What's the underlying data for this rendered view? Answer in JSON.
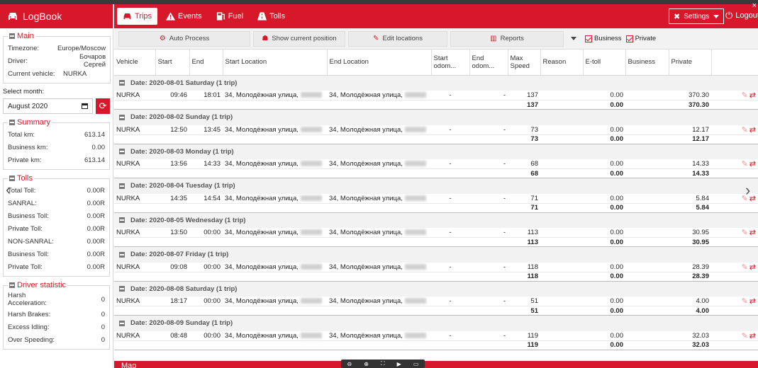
{
  "app": {
    "title": "LogBook"
  },
  "sidebar": {
    "main": {
      "legend": "Main",
      "rows": [
        {
          "k": "Timezone:",
          "v": "Europe/Moscow"
        },
        {
          "k": "Driver:",
          "v": "Бочаров Сергей"
        },
        {
          "k": "Current vehicle:",
          "v": "NURKA"
        }
      ]
    },
    "select_month_label": "Select month:",
    "month_value": "August 2020",
    "summary": {
      "legend": "Summary",
      "rows": [
        {
          "k": "Total km:",
          "v": "613.14"
        },
        {
          "k": "Business km:",
          "v": "0.00"
        },
        {
          "k": "Private km:",
          "v": "613.14"
        }
      ]
    },
    "tolls": {
      "legend": "Tolls",
      "rows": [
        {
          "k": "Total Toll:",
          "v": "0.00R"
        },
        {
          "k": "SANRAL:",
          "v": "0.00R"
        },
        {
          "k": "Business Toll:",
          "v": "0.00R"
        },
        {
          "k": "Private Toll:",
          "v": "0.00R"
        },
        {
          "k": "NON-SANRAL:",
          "v": "0.00R"
        },
        {
          "k": "Business Toll:",
          "v": "0.00R"
        },
        {
          "k": "Private Toll:",
          "v": "0.00R"
        }
      ]
    },
    "driver_stat": {
      "legend": "Driver statistic",
      "rows": [
        {
          "k": "Harsh Acceleration:",
          "v": "0"
        },
        {
          "k": "Harsh Brakes:",
          "v": "0"
        },
        {
          "k": "Excess Idling:",
          "v": "0"
        },
        {
          "k": "Over Speeding:",
          "v": "0"
        }
      ]
    }
  },
  "nav": {
    "tabs": [
      "Trips",
      "Events",
      "Fuel",
      "Tolls"
    ],
    "settings": "Settings",
    "logout": "Logout"
  },
  "toolbar": {
    "auto_process": "Auto Process",
    "show_position": "Show current position",
    "edit_locations": "Edit locations",
    "reports": "Reports",
    "business": "Business",
    "private": "Private"
  },
  "table": {
    "headers": [
      "Vehicle",
      "Start",
      "End",
      "Start Location",
      "End Location",
      "Start odom...",
      "End odom...",
      "Max Speed",
      "Reason",
      "E-toll",
      "Business",
      "Private"
    ],
    "groups": [
      {
        "date": "Date: 2020-08-01 Saturday (1 trip)",
        "vehicle": "NURKA",
        "start": "09:46",
        "end": "18:01",
        "sloc": "34, Молодёжная улица,",
        "eloc": "34, Молодёжная улица,",
        "so": "-",
        "eo": "-",
        "speed": "137",
        "etoll": "0.00",
        "private": "370.30"
      },
      {
        "date": "Date: 2020-08-02 Sunday (1 trip)",
        "vehicle": "NURKA",
        "start": "12:50",
        "end": "13:45",
        "sloc": "34, Молодёжная улица,",
        "eloc": "34, Молодёжная улица,",
        "so": "-",
        "eo": "-",
        "speed": "73",
        "etoll": "0.00",
        "private": "12.17"
      },
      {
        "date": "Date: 2020-08-03 Monday (1 trip)",
        "vehicle": "NURKA",
        "start": "13:56",
        "end": "14:33",
        "sloc": "34, Молодёжная улица,",
        "eloc": "34, Молодёжная улица,",
        "so": "-",
        "eo": "-",
        "speed": "68",
        "etoll": "0.00",
        "private": "14.33"
      },
      {
        "date": "Date: 2020-08-04 Tuesday (1 trip)",
        "vehicle": "NURKA",
        "start": "14:35",
        "end": "14:54",
        "sloc": "34, Молодёжная улица,",
        "eloc": "34, Молодёжная улица,",
        "so": "-",
        "eo": "-",
        "speed": "71",
        "etoll": "0.00",
        "private": "5.84"
      },
      {
        "date": "Date: 2020-08-05 Wednesday (1 trip)",
        "vehicle": "NURKA",
        "start": "13:50",
        "end": "00:00",
        "sloc": "34, Молодёжная улица,",
        "eloc": "34, Молодёжная улица,",
        "so": "-",
        "eo": "-",
        "speed": "113",
        "etoll": "0.00",
        "private": "30.95"
      },
      {
        "date": "Date: 2020-08-07 Friday (1 trip)",
        "vehicle": "NURKA",
        "start": "09:08",
        "end": "00:00",
        "sloc": "34, Молодёжная улица,",
        "eloc": "34, Молодёжная улица,",
        "so": "-",
        "eo": "-",
        "speed": "118",
        "etoll": "0.00",
        "private": "28.39"
      },
      {
        "date": "Date: 2020-08-08 Saturday (1 trip)",
        "vehicle": "NURKA",
        "start": "18:17",
        "end": "00:00",
        "sloc": "34, Молодёжная улица,",
        "eloc": "34, Молодёжная улица,",
        "so": "-",
        "eo": "-",
        "speed": "51",
        "etoll": "0.00",
        "private": "4.00"
      },
      {
        "date": "Date: 2020-08-09 Sunday (1 trip)",
        "vehicle": "NURKA",
        "start": "08:48",
        "end": "00:00",
        "sloc": "34, Молодёжная улица,",
        "eloc": "34, Молодёжная улица,",
        "so": "-",
        "eo": "-",
        "speed": "119",
        "etoll": "0.00",
        "private": "32.03"
      }
    ]
  },
  "bottom": {
    "map_label": "Map"
  },
  "colors": {
    "accent": "#d7182a"
  }
}
